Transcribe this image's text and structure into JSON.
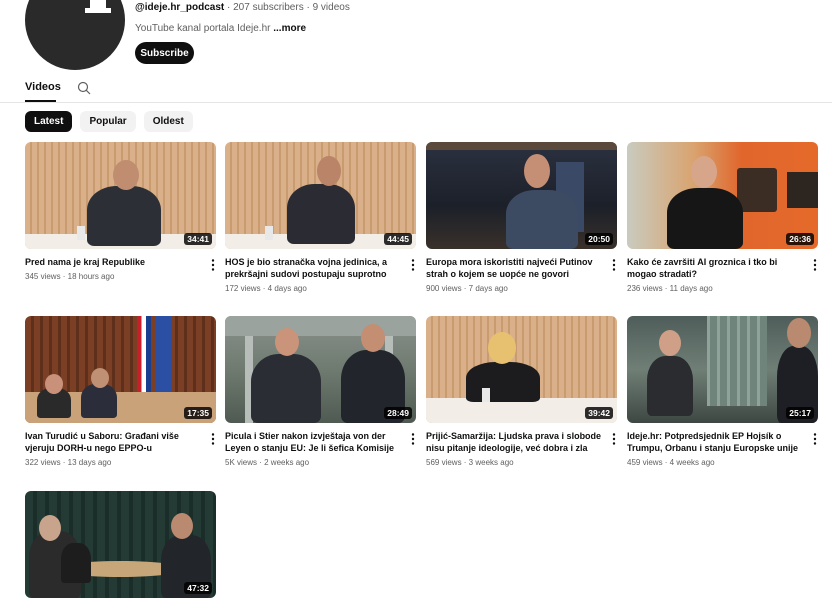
{
  "channel": {
    "handle": "@ideje.hr_podcast",
    "stats": " · 207 subscribers · 9 videos",
    "description": "YouTube kanal portala Ideje.hr ",
    "more_label": "...more",
    "subscribe_label": "Subscribe",
    "avatar_letter": "i"
  },
  "tabs": {
    "videos": "Videos"
  },
  "chips": [
    "Latest",
    "Popular",
    "Oldest"
  ],
  "videos": [
    {
      "title": "Pred nama je kraj Republike",
      "stats": "345 views · 18 hours ago",
      "duration": "34:41"
    },
    {
      "title": "HOS je bio stranačka vojna jedinica, a prekršajni sudovi postupaju suprotno Ustavu",
      "stats": "172 views · 4 days ago",
      "duration": "44:45"
    },
    {
      "title": "Europa mora iskoristiti najveći Putinov strah o kojem se uopće ne govori",
      "stats": "900 views · 7 days ago",
      "duration": "20:50"
    },
    {
      "title": "Kako će završiti AI groznica i tko bi mogao stradati?",
      "stats": "236 views · 11 days ago",
      "duration": "26:36"
    },
    {
      "title": "Ivan Turudić u Saboru: Građani više vjeruju DORH-u nego EPPO-u",
      "stats": "322 views · 13 days ago",
      "duration": "17:35"
    },
    {
      "title": "Picula i Stier nakon izvještaja von der Leyen o stanju EU: Je li šefica Komisije dorasla...",
      "stats": "5K views · 2 weeks ago",
      "duration": "28:49"
    },
    {
      "title": "Prijić-Samaržija: Ljudska prava i slobode nisu pitanje ideologije, već dobra i zla",
      "stats": "569 views · 3 weeks ago",
      "duration": "39:42"
    },
    {
      "title": "Ideje.hr: Potpredsjednik EP Hojsík o Trumpu, Orbanu i stanju Europske unije (Ep. 2)",
      "stats": "459 views · 4 weeks ago",
      "duration": "25:17"
    },
    {
      "title": "",
      "stats": "",
      "duration": "47:32"
    }
  ]
}
